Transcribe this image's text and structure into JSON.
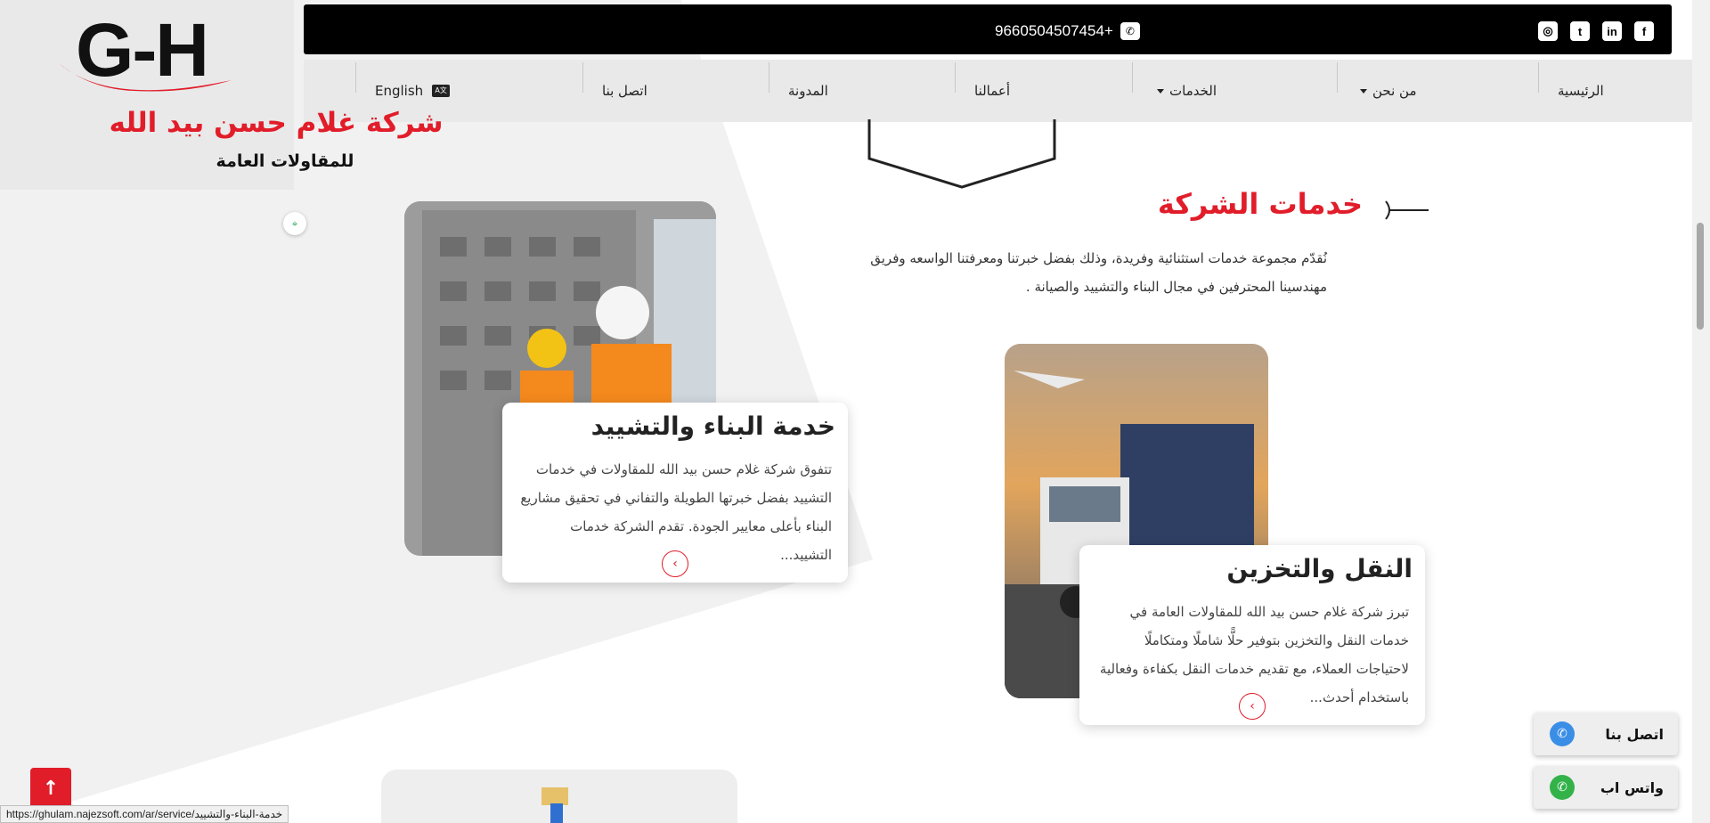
{
  "topbar": {
    "phone": "9660504507454+",
    "socials": [
      {
        "name": "facebook",
        "glyph": "f"
      },
      {
        "name": "linkedin",
        "glyph": "in"
      },
      {
        "name": "twitter",
        "glyph": "t"
      },
      {
        "name": "instagram",
        "glyph": "◎"
      }
    ]
  },
  "nav": {
    "home": "الرئيسية",
    "about": "من نحن",
    "services": "الخدمات",
    "works": "أعمالنا",
    "blog": "المدونة",
    "contact": "اتصل بنا",
    "language": "English"
  },
  "brand": {
    "logo_text": "G-H",
    "name": "شركة غلام حسن بيد الله",
    "subtitle": "للمقاولات العامة",
    "accent_color": "#e11d2a"
  },
  "section": {
    "title": "خدمات الشركة",
    "description": "نُقدّم مجموعة خدمات استثنائية وفريدة، وذلك بفضل خبرتنا ومعرفتنا الواسعه وفريق مهندسينا المحترفين في مجال البناء والتشييد والصيانة ."
  },
  "services": [
    {
      "title": "خدمة البناء والتشييد",
      "text": "تتفوق شركة غلام حسن بيد الله للمقاولات في خدمات التشييد بفضل خبرتها الطويلة والتفاني في تحقيق مشاريع البناء بأعلى معايير الجودة. تقدم الشركة خدمات التشييد..."
    },
    {
      "title": "النقل والتخزين",
      "text": "تبرز شركة غلام حسن بيد الله للمقاولات العامة في خدمات النقل والتخزين بتوفير حلًّا شاملًا ومتكاملًا لاحتياجات العملاء، مع تقديم خدمات النقل بكفاءة وفعالية باستخدام أحدث..."
    }
  ],
  "floating": {
    "call_label": "اتصل بنا",
    "whatsapp_label": "واتس اب"
  },
  "status_url": "https://ghulam.najezsoft.com/ar/service/خدمة-البناء-والتشييد"
}
